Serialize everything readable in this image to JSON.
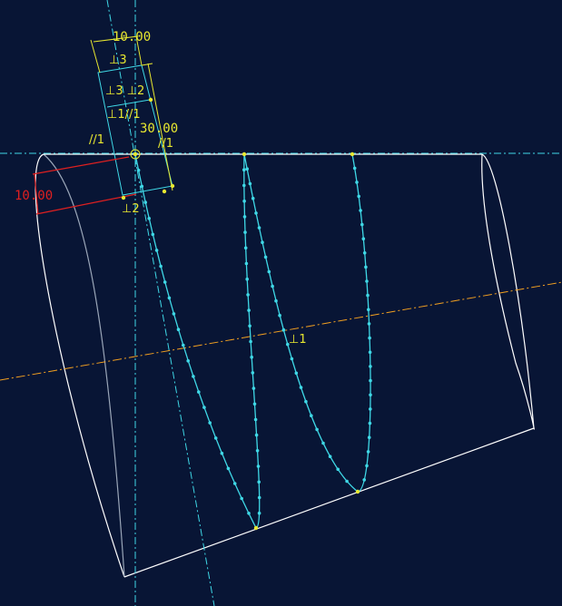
{
  "colors": {
    "background": "#081535",
    "geometry": "#FFFFFF",
    "geometry_dim": "#9AA6B8",
    "curve": "#3FD8E6",
    "centerline": "#3FD8E6",
    "axis": "#F2A020",
    "dimension": "#E8E830",
    "dimension_active": "#E02020",
    "point": "#E8E830"
  },
  "dimensions": {
    "d1": "10.00",
    "d2": "30.00",
    "d3": "10.00"
  },
  "constraints": {
    "perp3_top": "⊥3",
    "perp3_2": "⊥3 ⊥2",
    "perp1_par": "⊥1//1",
    "par1_left": "//1",
    "par1_right": "//1",
    "perp2": "⊥2",
    "perp1_center": "⊥1"
  }
}
